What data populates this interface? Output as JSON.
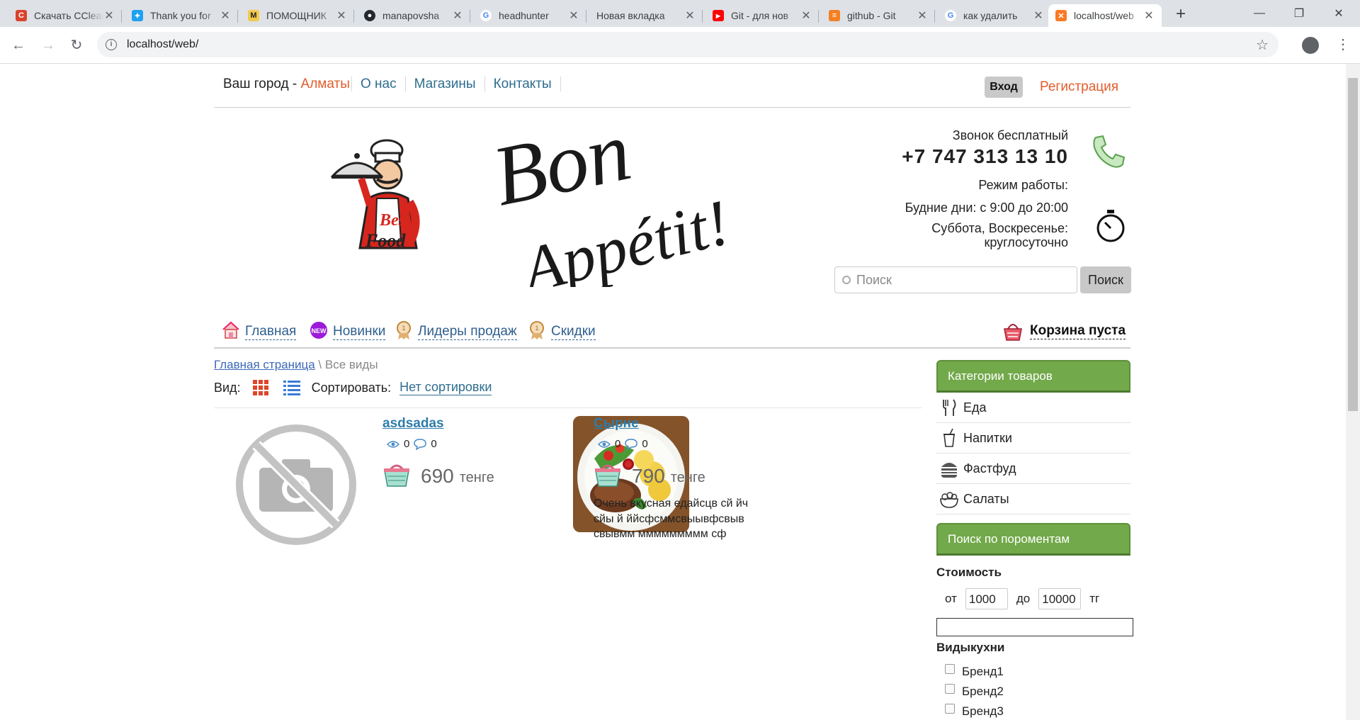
{
  "browser": {
    "tabs": [
      {
        "title": "Скачать CCleaner",
        "favicon": "ccleaner-icon",
        "color": "#d9432c"
      },
      {
        "title": "Thank you for",
        "favicon": "bird-icon",
        "color": "#1da1f2"
      },
      {
        "title": "ПОМОЩНИК",
        "favicon": "m-logo-icon",
        "color": "#f2c94c"
      },
      {
        "title": "manapovsha",
        "favicon": "github-icon",
        "color": "#24292e"
      },
      {
        "title": "headhunter",
        "favicon": "google-icon",
        "color": "#4285f4"
      },
      {
        "title": "Новая вкладка",
        "favicon": "none",
        "color": "#dee1e6"
      },
      {
        "title": "Git - для нов",
        "favicon": "youtube-icon",
        "color": "#ff0000"
      },
      {
        "title": "github - Git",
        "favicon": "stackoverflow-icon",
        "color": "#f48024"
      },
      {
        "title": "как удалить",
        "favicon": "google-icon",
        "color": "#4285f4"
      },
      {
        "title": "localhost/web",
        "favicon": "xampp-icon",
        "color": "#fb7a24"
      }
    ],
    "url": "localhost/web/"
  },
  "topnav": {
    "city_prefix": "Ваш город - ",
    "city": "Алматы",
    "menu": [
      "О нас",
      "Магазины",
      "Контакты"
    ],
    "login": "Вход",
    "register": "Регистрация"
  },
  "header": {
    "logo_text_1": "Best",
    "logo_text_2": "Food",
    "brand_line_1": "Bon",
    "brand_line_2": "Appétit!",
    "call_label": "Звонок бесплатный",
    "phone": "+7 747 313 13 10",
    "hours_label": "Режим работы:",
    "weekdays": "Будние дни: с 9:00 до 20:00",
    "weekend_1": "Суббота, Воскресенье:",
    "weekend_2": "круглосуточно",
    "search_placeholder": "Поиск",
    "search_button": "Поиск"
  },
  "mainnav": {
    "items": [
      {
        "label": "Главная",
        "icon": "house-icon"
      },
      {
        "label": "Новинки",
        "icon": "new-badge-icon"
      },
      {
        "label": "Лидеры продаж",
        "icon": "medal-icon"
      },
      {
        "label": "Скидки",
        "icon": "medal-icon"
      }
    ],
    "cart": "Корзина пуста"
  },
  "breadcrumb": {
    "home": "Главная страница",
    "sep": " \\ ",
    "current": "Все виды"
  },
  "viewbar": {
    "view_label": "Вид:",
    "sort_label": "Сортировать:",
    "sort_value": "Нет сортировки"
  },
  "products": [
    {
      "title": "asdsadas",
      "views": "0",
      "comments": "0",
      "price": "690",
      "currency": "тенге",
      "desc_1": "",
      "desc_2": "",
      "desc_3": "",
      "image": "no-photo-icon"
    },
    {
      "title": "Сырне",
      "views": "0",
      "comments": "0",
      "price": "790",
      "currency": "тенге",
      "desc_1": "Очень вкусная едайсцв сй йч",
      "desc_2": "сйы й ййсфсммсвыывфсвыв",
      "desc_3": "свывмм ммммммммм сф",
      "image": "food-plate-photo"
    }
  ],
  "sidebar": {
    "categories_title": "Категории товаров",
    "categories": [
      {
        "label": "Еда",
        "icon": "fork-knife-icon"
      },
      {
        "label": "Напитки",
        "icon": "cup-icon"
      },
      {
        "label": "Фастфуд",
        "icon": "burger-icon"
      },
      {
        "label": "Салаты",
        "icon": "salad-bowl-icon"
      }
    ],
    "search_title": "Поиск по пороментам",
    "price_label": "Стоимость",
    "from_label": "от",
    "from_value": "1000",
    "to_label": "до",
    "to_value": "10000",
    "currency": "тг",
    "cuisine_label": "Видыкухни",
    "brands": [
      "Бренд1",
      "Бренд2",
      "Бренд3"
    ]
  },
  "colors": {
    "accent": "#e35c2b",
    "link": "#2e7daa",
    "green": "#72a94a"
  }
}
